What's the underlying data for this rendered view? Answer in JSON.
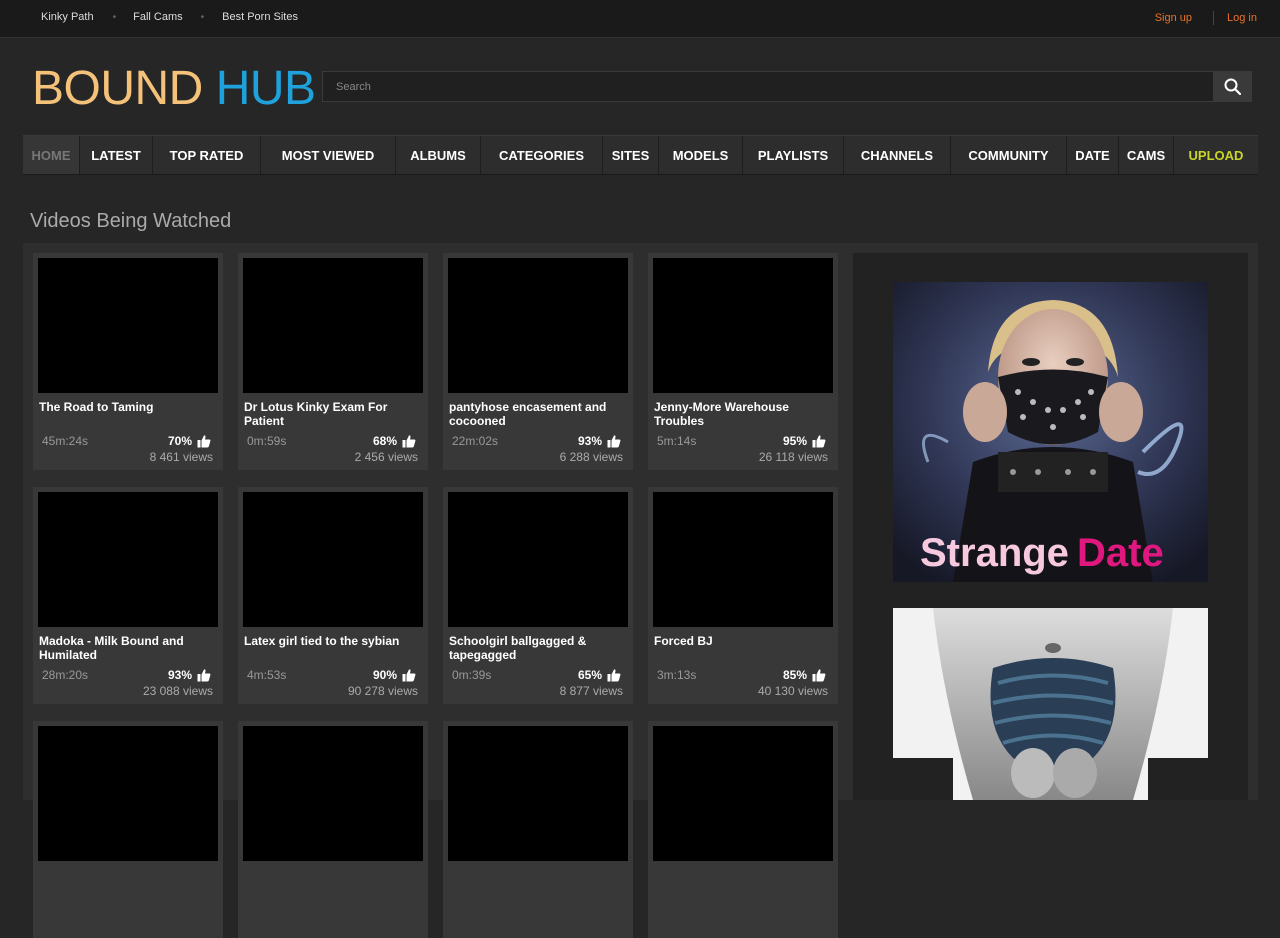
{
  "topbar": {
    "links": [
      "Kinky Path",
      "Fall Cams",
      "Best Porn Sites"
    ],
    "signup": "Sign up",
    "login": "Log in"
  },
  "logo": {
    "part1": "BOUND",
    "part2": "HUB"
  },
  "search": {
    "placeholder": "Search"
  },
  "nav": [
    "HOME",
    "LATEST",
    "TOP RATED",
    "MOST VIEWED",
    "ALBUMS",
    "CATEGORIES",
    "SITES",
    "MODELS",
    "PLAYLISTS",
    "CHANNELS",
    "COMMUNITY",
    "DATE",
    "CAMS",
    "UPLOAD"
  ],
  "section_title": "Videos Being Watched",
  "videos": [
    {
      "title": "The Road to Taming",
      "duration": "45m:24s",
      "rating": "70%",
      "views": "8 461 views"
    },
    {
      "title": "Dr Lotus Kinky Exam For Patient",
      "duration": "0m:59s",
      "rating": "68%",
      "views": "2 456 views"
    },
    {
      "title": "pantyhose encasement and cocooned",
      "duration": "22m:02s",
      "rating": "93%",
      "views": "6 288 views"
    },
    {
      "title": "Jenny-More Warehouse Troubles",
      "duration": "5m:14s",
      "rating": "95%",
      "views": "26 118 views"
    },
    {
      "title": "Madoka - Milk Bound and Humilated",
      "duration": "28m:20s",
      "rating": "93%",
      "views": "23 088 views"
    },
    {
      "title": "Latex girl tied to the sybian",
      "duration": "4m:53s",
      "rating": "90%",
      "views": "90 278 views"
    },
    {
      "title": "Schoolgirl ballgagged & tapegagged",
      "duration": "0m:39s",
      "rating": "65%",
      "views": "8 877 views"
    },
    {
      "title": "Forced BJ",
      "duration": "3m:13s",
      "rating": "85%",
      "views": "40 130 views"
    },
    {
      "title": "",
      "duration": "",
      "rating": "",
      "views": ""
    },
    {
      "title": "",
      "duration": "",
      "rating": "",
      "views": ""
    },
    {
      "title": "",
      "duration": "",
      "rating": "",
      "views": ""
    },
    {
      "title": "",
      "duration": "",
      "rating": "",
      "views": ""
    }
  ],
  "ads": {
    "ad1_text_a": "Strange",
    "ad1_text_b": "Date"
  },
  "icons": {
    "search": "search-icon",
    "like": "thumbs-up-icon"
  },
  "colors": {
    "accent_orange": "#e8722a",
    "logo_gold": "#f5c27a",
    "logo_blue": "#1fa2dc",
    "upload": "#c8d629"
  }
}
